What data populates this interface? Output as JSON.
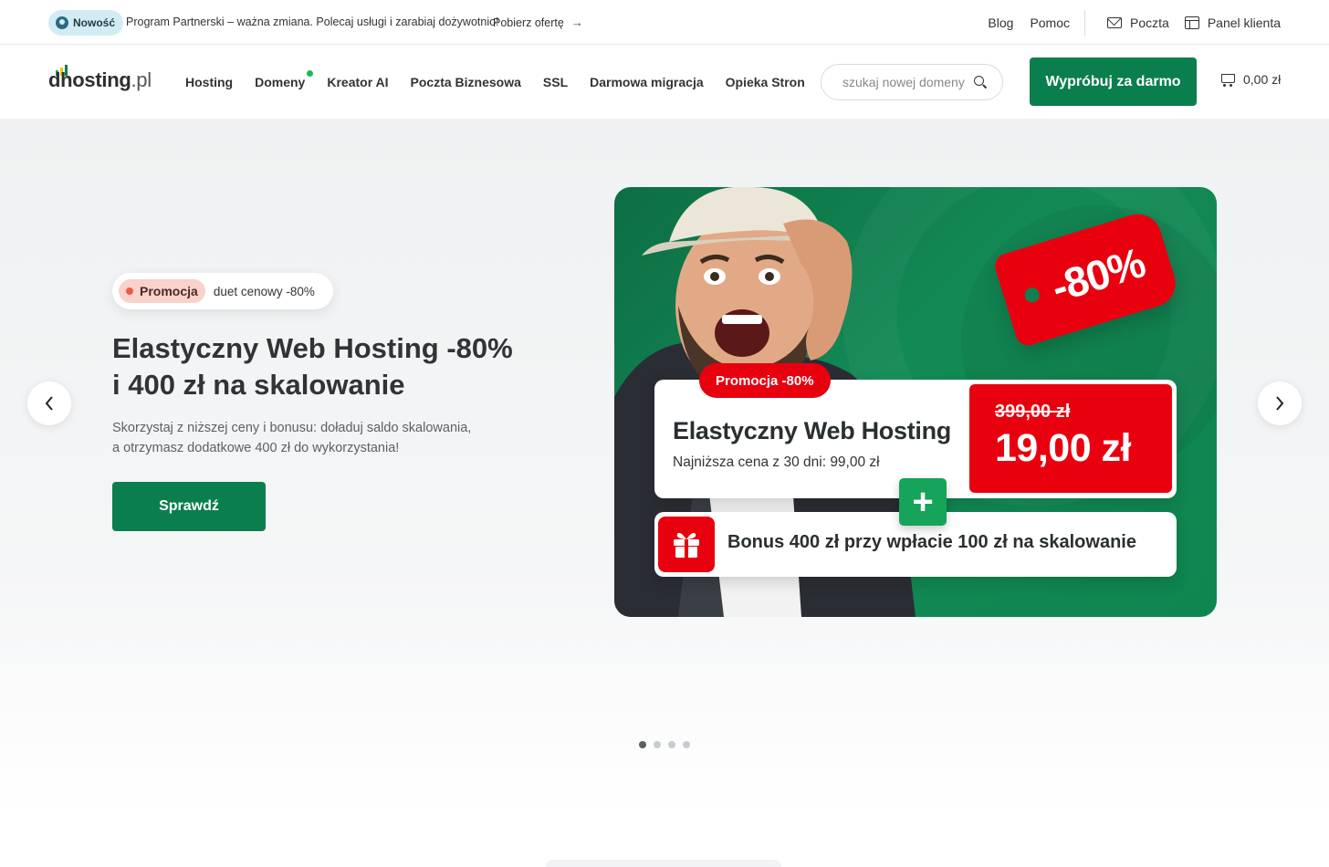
{
  "topbar": {
    "badge": "Nowość",
    "message": "Program Partnerski – ważna zmiana. Polecaj usługi i zarabiaj dożywotnio!",
    "link": "Pobierz ofertę",
    "links": [
      "Blog",
      "Pomoc"
    ],
    "mail": "Poczta",
    "panel": "Panel klienta"
  },
  "header": {
    "logo_main": "dhosting",
    "logo_tld": ".pl",
    "nav": [
      "Hosting",
      "Domeny",
      "Kreator AI",
      "Poczta Biznesowa",
      "SSL",
      "Darmowa migracja",
      "Opieka Stron"
    ],
    "search_placeholder": "szukaj nowej domeny",
    "cta": "Wypróbuj za darmo",
    "cart_total": "0,00 zł"
  },
  "hero": {
    "promo_tag": "Promocja",
    "promo_sub": "duet cenowy -80%",
    "title_line1": "Elastyczny Web Hosting -80%",
    "title_line2": "i 400 zł na skalowanie",
    "desc_line1": "Skorzystaj z niższej ceny i bonusu: doładuj saldo skalowania,",
    "desc_line2": "a otrzymasz dodatkowe 400 zł do wykorzystania!",
    "button": "Sprawdź",
    "slide_count": 4,
    "active_slide": 1
  },
  "banner": {
    "discount": "-80%",
    "promo": "Promocja -80%",
    "title": "Elastyczny Web Hosting",
    "subtitle": "Najniższa cena z 30 dni: 99,00 zł",
    "old_price": "399,00 zł",
    "new_price": "19,00 zł",
    "plus": "+",
    "bonus": "Bonus 400 zł przy wpłacie 100 zł na skalowanie"
  },
  "colors": {
    "brand_green": "#0b7e4e",
    "promo_red": "#e8000f",
    "domain_dot": "#1db954"
  }
}
